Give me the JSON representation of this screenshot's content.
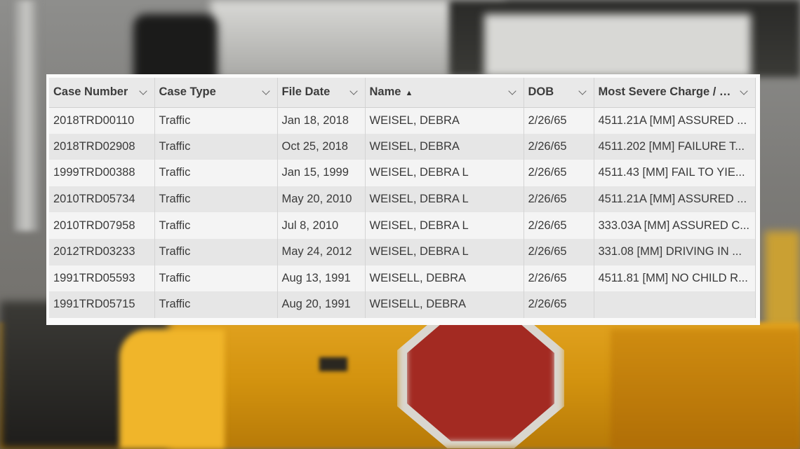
{
  "grid": {
    "columns": [
      {
        "label": "Case Number",
        "sorted": false
      },
      {
        "label": "Case Type",
        "sorted": false
      },
      {
        "label": "File Date",
        "sorted": false
      },
      {
        "label": "Name",
        "sorted": true,
        "sort_icon": "sort-ascending-icon"
      },
      {
        "label": "DOB",
        "sorted": false
      },
      {
        "label": "Most Severe Charge / Op...",
        "sorted": false
      }
    ],
    "rows": [
      [
        "2018TRD00110",
        "Traffic",
        "Jan 18, 2018",
        "WEISEL, DEBRA",
        "2/26/65",
        "4511.21A [MM] ASSURED ..."
      ],
      [
        "2018TRD02908",
        "Traffic",
        "Oct 25, 2018",
        "WEISEL, DEBRA",
        "2/26/65",
        "4511.202 [MM] FAILURE T..."
      ],
      [
        "1999TRD00388",
        "Traffic",
        "Jan 15, 1999",
        "WEISEL, DEBRA L",
        "2/26/65",
        "4511.43 [MM] FAIL TO YIE..."
      ],
      [
        "2010TRD05734",
        "Traffic",
        "May 20, 2010",
        "WEISEL, DEBRA L",
        "2/26/65",
        "4511.21A [MM] ASSURED ..."
      ],
      [
        "2010TRD07958",
        "Traffic",
        "Jul 8, 2010",
        "WEISEL, DEBRA L",
        "2/26/65",
        "333.03A [MM] ASSURED C..."
      ],
      [
        "2012TRD03233",
        "Traffic",
        "May 24, 2012",
        "WEISEL, DEBRA L",
        "2/26/65",
        "331.08 [MM] DRIVING IN ..."
      ],
      [
        "1991TRD05593",
        "Traffic",
        "Aug 13, 1991",
        "WEISELL, DEBRA",
        "2/26/65",
        "4511.81 [MM] NO CHILD R..."
      ],
      [
        "1991TRD05715",
        "Traffic",
        "Aug 20, 1991",
        "WEISELL, DEBRA",
        "2/26/65",
        ""
      ]
    ]
  }
}
